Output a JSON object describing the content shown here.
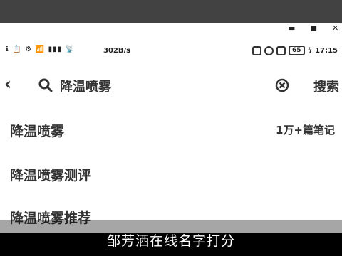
{
  "window": {
    "minimize": "▬",
    "maximize": "◼",
    "close": "✕"
  },
  "status_bar": {
    "left_icons": "ℹ 📋 ⚙ 📶 ▮▮▮ 📡",
    "network_speed": "302B/s",
    "battery": "65",
    "time": "17:15"
  },
  "search": {
    "query": "降温喷雾",
    "search_button": "搜索"
  },
  "suggestions": [
    {
      "text": "降温喷雾"
    },
    {
      "text": "降温喷雾测评"
    },
    {
      "text": "降温喷雾推荐"
    }
  ],
  "first_suggestion_count": "1万+篇笔记",
  "subtitle": "邹芳洒在线名字打分"
}
